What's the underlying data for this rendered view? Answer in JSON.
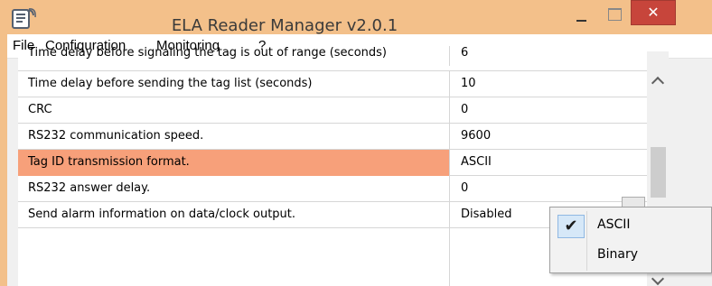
{
  "window": {
    "title": "ELA Reader Manager v2.0.1",
    "close_glyph": "✕",
    "accent_color": "#f3c08a",
    "close_color": "#c7453b"
  },
  "menu": {
    "items": [
      "File",
      "Configuration",
      "Monitoring",
      "?"
    ]
  },
  "properties": [
    {
      "name": "Time delay before signaling the tag is out of range (seconds)",
      "value": "6"
    },
    {
      "name": "Time delay before sending the tag list (seconds)",
      "value": "10"
    },
    {
      "name": "CRC",
      "value": "0"
    },
    {
      "name": "RS232 communication speed.",
      "value": "9600"
    },
    {
      "name": "Tag ID transmission format.",
      "value": "ASCII",
      "selected": true
    },
    {
      "name": "RS232 answer delay.",
      "value": "0"
    },
    {
      "name": "Send alarm information on data/clock output.",
      "value": "Disabled"
    }
  ],
  "popup": {
    "options": [
      {
        "label": "ASCII",
        "checked": true,
        "check_glyph": "✔"
      },
      {
        "label": "Binary",
        "checked": false
      }
    ]
  },
  "colors": {
    "selected_row": "#f7a07a",
    "check_highlight": "#d6e8f8"
  }
}
